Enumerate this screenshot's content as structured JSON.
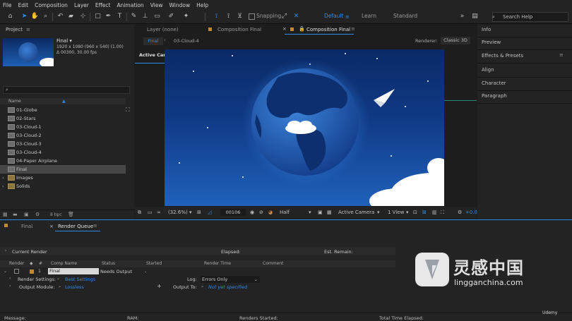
{
  "menu": [
    "File",
    "Edit",
    "Composition",
    "Layer",
    "Effect",
    "Animation",
    "View",
    "Window",
    "Help"
  ],
  "toolbar": {
    "snapping_label": "Snapping"
  },
  "workspaces": {
    "items": [
      "Default",
      "Learn",
      "Standard"
    ],
    "active": "Default"
  },
  "search": {
    "placeholder": "Search Help"
  },
  "project": {
    "panel_title": "Project",
    "comp_name": "Final ▾",
    "comp_info1": "1920 x 1080  (960 x 540) (1.00)",
    "comp_info2": "Δ 00300, 30.00 fps",
    "name_header": "Name",
    "items": [
      {
        "name": "01-Globe",
        "type": "comp"
      },
      {
        "name": "02-Stars",
        "type": "comp"
      },
      {
        "name": "03-Cloud-1",
        "type": "comp"
      },
      {
        "name": "03-Cloud-2",
        "type": "comp"
      },
      {
        "name": "03-Cloud-3",
        "type": "comp"
      },
      {
        "name": "03-Cloud-4",
        "type": "comp"
      },
      {
        "name": "04-Paper Airplane",
        "type": "comp"
      },
      {
        "name": "Final",
        "type": "comp",
        "selected": true
      },
      {
        "name": "Images",
        "type": "folder"
      },
      {
        "name": "Solids",
        "type": "folder"
      }
    ],
    "bpc": "8 bpc"
  },
  "viewer": {
    "layer_tab": "Layer (none)",
    "comp_tab1": "Composition Final",
    "comp_tab2": "Composition Final",
    "breadcrumb1": "Final",
    "breadcrumb2": "03-Cloud-4",
    "renderer_label": "Renderer:",
    "renderer_value": "Classic 3D",
    "active_camera_label": "Active Camera",
    "zoom": "(32.6%)",
    "timecode": "00106",
    "resolution": "Half",
    "camera_select": "Active Camera",
    "views_select": "1 View",
    "exposure": "+0.0"
  },
  "right_panels": [
    "Info",
    "Preview",
    "Effects & Presets",
    "Align",
    "Character",
    "Paragraph"
  ],
  "bottom": {
    "tab_final": "Final",
    "tab_render_queue": "Render Queue",
    "current_render": "Current Render",
    "elapsed": "Elapsed:",
    "est_remain": "Est. Remain:",
    "columns": [
      "Render",
      "#",
      "Comp Name",
      "Status",
      "Started",
      "Render Time",
      "Comment"
    ],
    "row": {
      "number": "1",
      "comp_name": "Final",
      "status": "Needs Output",
      "started": "-"
    },
    "render_settings_label": "Render Settings:",
    "render_settings_value": "Best Settings",
    "log_label": "Log:",
    "log_value": "Errors Only",
    "output_module_label": "Output Module:",
    "output_module_value": "Lossless",
    "output_to_label": "Output To:",
    "output_to_value": "Not yet specified",
    "footer": {
      "message": "Message:",
      "ram": "RAM:",
      "renders_started": "Renders Started:",
      "total_time": "Total Time Elapsed:"
    }
  },
  "watermark": {
    "brand": "灵感中国",
    "domain": "lingganchina.com",
    "udemy": "Udemy"
  }
}
